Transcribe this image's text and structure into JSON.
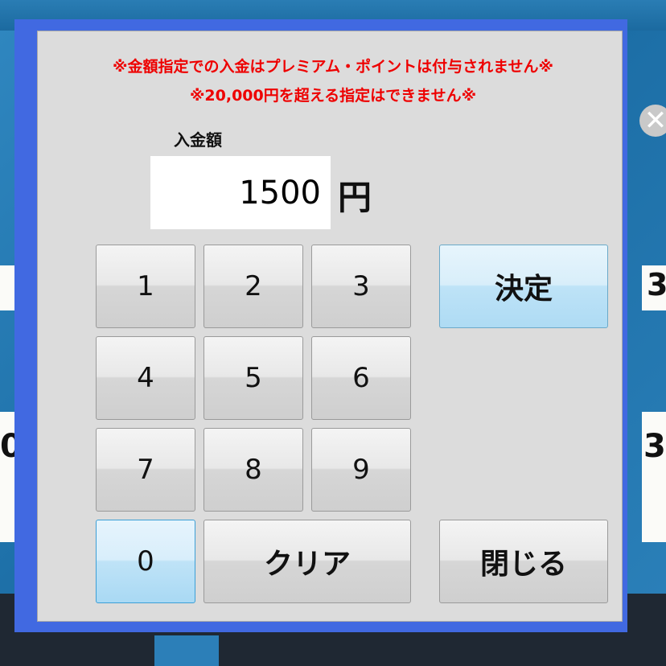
{
  "dialog": {
    "notice_line1": "※金額指定での入金はプレミアム・ポイントは付与されません※",
    "notice_line2": "※20,000円を超える指定はできません※",
    "amount_label": "入金額",
    "amount_value": "1500",
    "unit": "円",
    "keys": {
      "k1": "1",
      "k2": "2",
      "k3": "3",
      "k4": "4",
      "k5": "5",
      "k6": "6",
      "k7": "7",
      "k8": "8",
      "k9": "9",
      "k0": "0",
      "clear": "クリア",
      "confirm": "決定",
      "close": "閉じる"
    }
  },
  "background": {
    "right_digit": "3",
    "left_digit": "0",
    "right_partial": "3,",
    "close_symbol": "✕"
  },
  "colors": {
    "dialog_border": "#4169e1",
    "notice_text": "#ee0000",
    "panel": "#dcdcdc",
    "active_key": "#bfe3f7"
  }
}
